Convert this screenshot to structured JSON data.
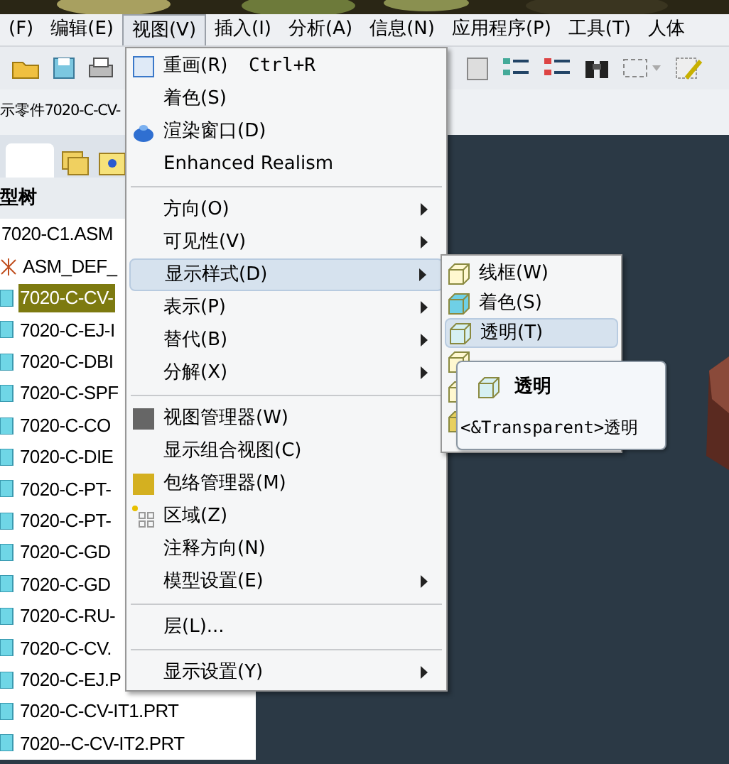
{
  "menubar": [
    {
      "label": "(F)",
      "selected": false
    },
    {
      "label": "编辑(E)",
      "selected": false
    },
    {
      "label": "视图(V)",
      "selected": true
    },
    {
      "label": "插入(I)",
      "selected": false
    },
    {
      "label": "分析(A)",
      "selected": false
    },
    {
      "label": "信息(N)",
      "selected": false
    },
    {
      "label": "应用程序(P)",
      "selected": false
    },
    {
      "label": "工具(T)",
      "selected": false
    },
    {
      "label": "人体",
      "selected": false
    }
  ],
  "model_title": "示零件7020-C-CV-",
  "tree": {
    "header": "型树",
    "items": [
      {
        "label": "7020-C1.ASM",
        "kind": "asm",
        "selected": false
      },
      {
        "label": "ASM_DEF_",
        "kind": "def",
        "selected": false
      },
      {
        "label": "7020-C-CV-",
        "kind": "part",
        "selected": true
      },
      {
        "label": "7020-C-EJ-I",
        "kind": "part",
        "selected": false
      },
      {
        "label": "7020-C-DBI",
        "kind": "part",
        "selected": false
      },
      {
        "label": "7020-C-SPF",
        "kind": "part",
        "selected": false
      },
      {
        "label": "7020-C-CO",
        "kind": "part",
        "selected": false
      },
      {
        "label": "7020-C-DIE",
        "kind": "part",
        "selected": false
      },
      {
        "label": "7020-C-PT-",
        "kind": "part",
        "selected": false
      },
      {
        "label": "7020-C-PT-",
        "kind": "part",
        "selected": false
      },
      {
        "label": "7020-C-GD",
        "kind": "part",
        "selected": false
      },
      {
        "label": "7020-C-GD",
        "kind": "part",
        "selected": false
      },
      {
        "label": "7020-C-RU-",
        "kind": "part",
        "selected": false
      },
      {
        "label": "7020-C-CV.",
        "kind": "part",
        "selected": false
      },
      {
        "label": "7020-C-EJ.P",
        "kind": "part",
        "selected": false
      },
      {
        "label": "7020-C-CV-IT1.PRT",
        "kind": "part",
        "selected": false
      },
      {
        "label": "7020--C-CV-IT2.PRT",
        "kind": "part",
        "selected": false
      }
    ]
  },
  "menu": [
    {
      "kind": "item",
      "label": "重画(R)",
      "shortcut": "Ctrl+R",
      "submenu": false,
      "selected": false
    },
    {
      "kind": "item",
      "label": "着色(S)",
      "submenu": false,
      "selected": false
    },
    {
      "kind": "item",
      "label": "渲染窗口(D)",
      "submenu": false,
      "selected": false
    },
    {
      "kind": "item",
      "label": "Enhanced Realism",
      "submenu": false,
      "selected": false
    },
    {
      "kind": "separator"
    },
    {
      "kind": "item",
      "label": "方向(O)",
      "submenu": true,
      "selected": false
    },
    {
      "kind": "item",
      "label": "可见性(V)",
      "submenu": true,
      "selected": false
    },
    {
      "kind": "item",
      "label": "显示样式(D)",
      "submenu": true,
      "selected": true
    },
    {
      "kind": "item",
      "label": "表示(P)",
      "submenu": true,
      "selected": false
    },
    {
      "kind": "item",
      "label": "替代(B)",
      "submenu": true,
      "selected": false
    },
    {
      "kind": "item",
      "label": "分解(X)",
      "submenu": true,
      "selected": false
    },
    {
      "kind": "separator"
    },
    {
      "kind": "item",
      "label": "视图管理器(W)",
      "submenu": false,
      "selected": false
    },
    {
      "kind": "item",
      "label": "显示组合视图(C)",
      "submenu": false,
      "selected": false
    },
    {
      "kind": "item",
      "label": "包络管理器(M)",
      "submenu": false,
      "selected": false
    },
    {
      "kind": "item",
      "label": "区域(Z)",
      "submenu": false,
      "selected": false
    },
    {
      "kind": "item",
      "label": "注释方向(N)",
      "submenu": false,
      "selected": false
    },
    {
      "kind": "item",
      "label": "模型设置(E)",
      "submenu": true,
      "selected": false
    },
    {
      "kind": "separator"
    },
    {
      "kind": "item",
      "label": "层(L)...",
      "submenu": false,
      "selected": false
    },
    {
      "kind": "separator"
    },
    {
      "kind": "item",
      "label": "显示设置(Y)",
      "submenu": true,
      "selected": false
    }
  ],
  "submenu": [
    {
      "label": "线框(W)",
      "selected": false
    },
    {
      "label": "着色(S)",
      "selected": false
    },
    {
      "label": "透明(T)",
      "selected": true
    }
  ],
  "tooltip": {
    "title": "透明",
    "description": "<&Transparent>透明"
  }
}
